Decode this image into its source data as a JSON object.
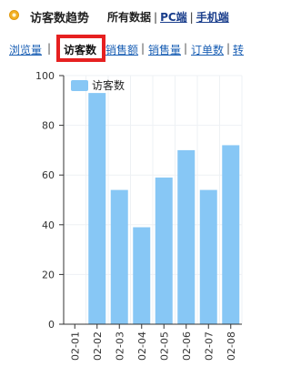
{
  "header": {
    "title": "访客数趋势",
    "filters": [
      "所有数据",
      "PC端",
      "手机端"
    ]
  },
  "tabs": {
    "items": [
      "浏览量",
      "访客数",
      "销售额",
      "销售量",
      "订单数",
      "转"
    ],
    "active": "访客数"
  },
  "colors": {
    "bar": "#87c7f5",
    "legend_swatch": "#87c7f5",
    "active_border": "#e62020",
    "link": "#1a5fb4"
  },
  "chart_data": {
    "type": "bar",
    "categories": [
      "02-01",
      "02-02",
      "02-03",
      "02-04",
      "02-05",
      "02-06",
      "02-07",
      "02-08"
    ],
    "series": [
      {
        "name": "访客数",
        "values": [
          0,
          93,
          54,
          39,
          59,
          70,
          54,
          72
        ]
      }
    ],
    "ylim": [
      0,
      100
    ],
    "yticks": [
      0,
      20,
      40,
      60,
      80,
      100
    ],
    "legend": "top-left",
    "grid": true
  }
}
